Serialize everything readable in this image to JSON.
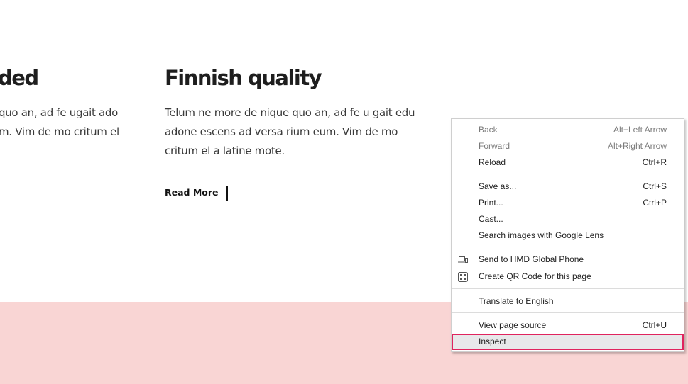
{
  "page": {
    "col1": {
      "heading": "ded",
      "lines": [
        "quo an, ad fe ugait ado",
        "m. Vim de mo critum el"
      ]
    },
    "col2": {
      "heading": "Finnish quality",
      "lines": [
        "Telum ne more de nique quo an, ad fe u gait edu",
        "adone escens ad versa rium eum. Vim de mo",
        "critum el a latine mote."
      ],
      "link": "Read More"
    },
    "colors": {
      "pink_section": "#f9d5d4",
      "highlight_border": "#e0245e"
    }
  },
  "menu": {
    "items": [
      {
        "label": "Back",
        "shortcut": "Alt+Left Arrow"
      },
      {
        "label": "Forward",
        "shortcut": "Alt+Right Arrow"
      },
      {
        "label": "Reload",
        "shortcut": "Ctrl+R"
      },
      {
        "label": "Save as...",
        "shortcut": "Ctrl+S"
      },
      {
        "label": "Print...",
        "shortcut": "Ctrl+P"
      },
      {
        "label": "Cast..."
      },
      {
        "label": "Search images with Google Lens"
      },
      {
        "label": "Send to HMD Global Phone",
        "icon": "devices-icon"
      },
      {
        "label": "Create QR Code for this page",
        "icon": "qr-code-icon"
      },
      {
        "label": "Translate to English"
      },
      {
        "label": "View page source",
        "shortcut": "Ctrl+U"
      },
      {
        "label": "Inspect"
      }
    ]
  }
}
